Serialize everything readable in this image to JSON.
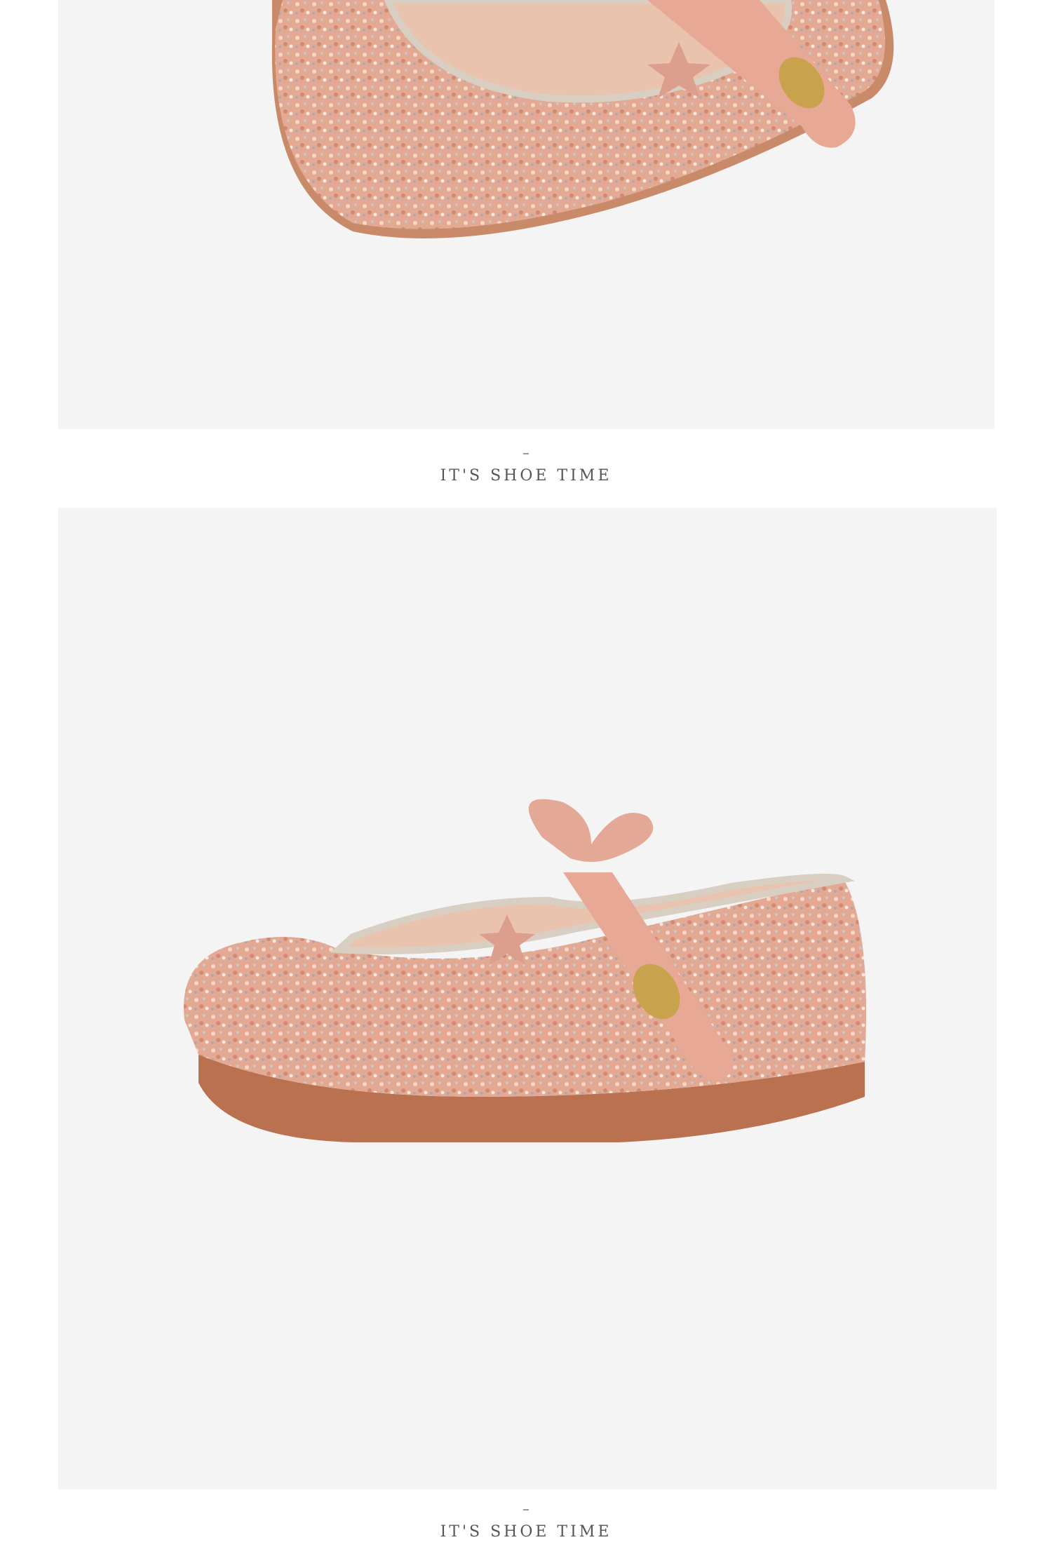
{
  "sections": [
    {
      "image": {
        "description": "pink glitter shoe top view",
        "icon": "shoe-top-view-image"
      },
      "caption": "IT'S SHOE TIME"
    },
    {
      "image": {
        "description": "pink glitter shoe side view",
        "icon": "shoe-side-view-image"
      },
      "caption": "IT'S SHOE TIME"
    }
  ],
  "colors": {
    "background": "#ffffff",
    "photo_bg": "#f4f4f4",
    "glitter": "#e8b39b",
    "sole": "#b9714f",
    "caption": "#555555"
  }
}
